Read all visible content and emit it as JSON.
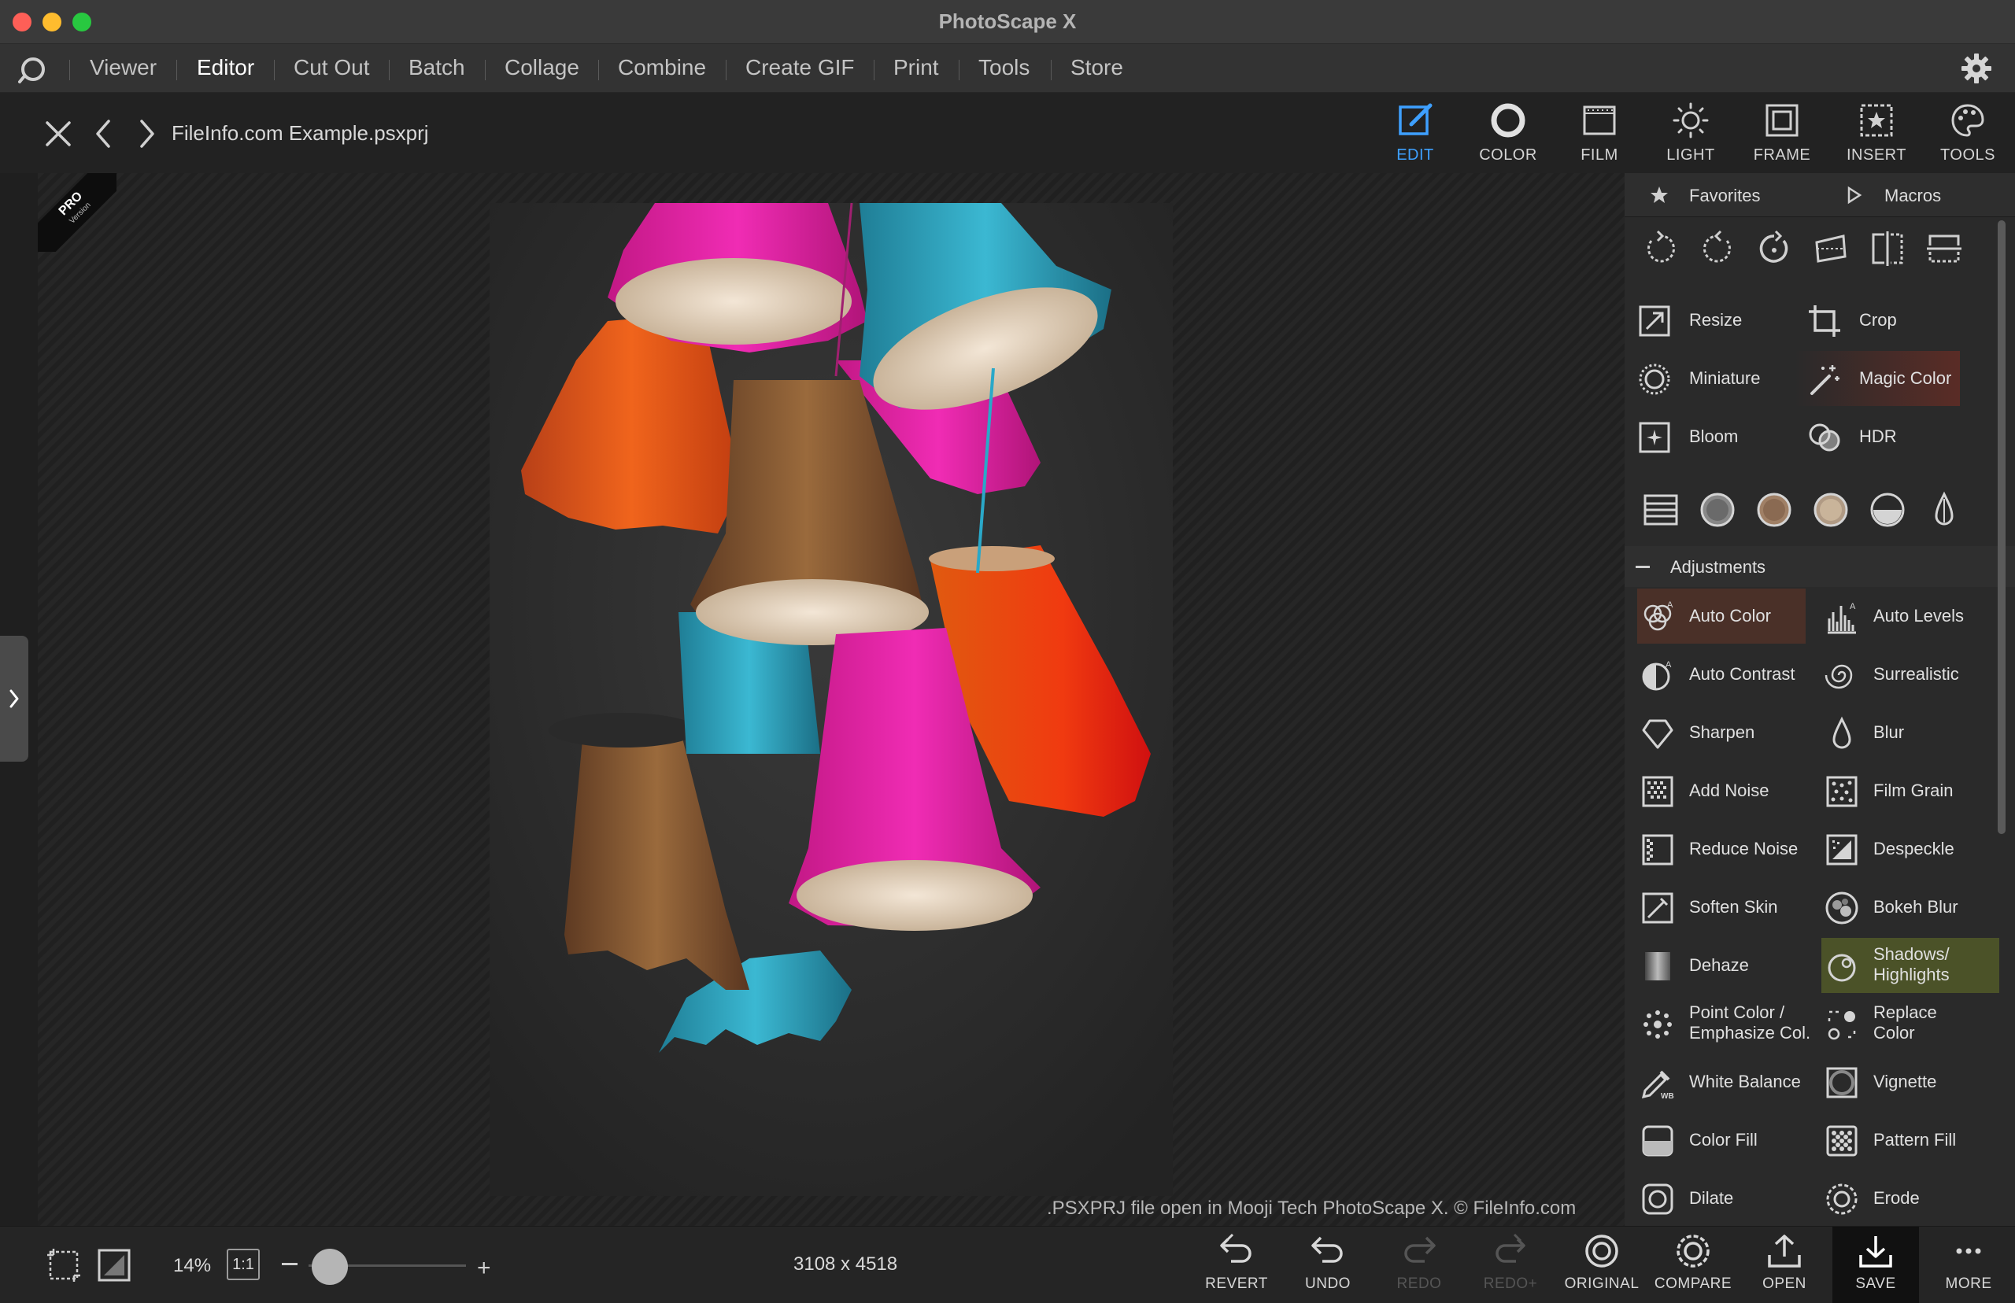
{
  "window": {
    "title": "PhotoScape X"
  },
  "menu": [
    {
      "label": "Viewer",
      "active": false
    },
    {
      "label": "Editor",
      "active": true
    },
    {
      "label": "Cut Out",
      "active": false
    },
    {
      "label": "Batch",
      "active": false
    },
    {
      "label": "Collage",
      "active": false
    },
    {
      "label": "Combine",
      "active": false
    },
    {
      "label": "Create GIF",
      "active": false
    },
    {
      "label": "Print",
      "active": false
    },
    {
      "label": "Tools",
      "active": false
    },
    {
      "label": "Store",
      "active": false
    }
  ],
  "file": {
    "name": "FileInfo.com Example.psxprj"
  },
  "tabs": [
    {
      "label": "EDIT",
      "icon": "edit-icon",
      "active": true
    },
    {
      "label": "COLOR",
      "icon": "color-icon",
      "active": false
    },
    {
      "label": "FILM",
      "icon": "film-icon",
      "active": false
    },
    {
      "label": "LIGHT",
      "icon": "light-icon",
      "active": false
    },
    {
      "label": "FRAME",
      "icon": "frame-icon",
      "active": false
    },
    {
      "label": "INSERT",
      "icon": "insert-icon",
      "active": false
    },
    {
      "label": "TOOLS",
      "icon": "tools-icon",
      "active": false
    }
  ],
  "accent": "#3ea0ff",
  "badge": {
    "line1": "PRO",
    "line2": "Version"
  },
  "watermark": ".PSXPRJ file open in Mooji Tech PhotoScape X. © FileInfo.com",
  "panel": {
    "favorites": "Favorites",
    "macros": "Macros",
    "tools_top": [
      {
        "label": "Resize",
        "icon": "resize-icon"
      },
      {
        "label": "Crop",
        "icon": "crop-icon"
      },
      {
        "label": "Miniature",
        "icon": "miniature-icon"
      },
      {
        "label": "Magic Color",
        "icon": "magic-wand-icon"
      },
      {
        "label": "Bloom",
        "icon": "bloom-icon"
      },
      {
        "label": "HDR",
        "icon": "hdr-icon"
      }
    ],
    "adjustments_title": "Adjustments",
    "adjustments": [
      {
        "label": "Auto Color",
        "icon": "auto-color-icon"
      },
      {
        "label": "Auto Levels",
        "icon": "auto-levels-icon"
      },
      {
        "label": "Auto Contrast",
        "icon": "auto-contrast-icon"
      },
      {
        "label": "Surrealistic",
        "icon": "surrealistic-icon"
      },
      {
        "label": "Sharpen",
        "icon": "sharpen-icon"
      },
      {
        "label": "Blur",
        "icon": "blur-icon"
      },
      {
        "label": "Add Noise",
        "icon": "add-noise-icon"
      },
      {
        "label": "Film Grain",
        "icon": "film-grain-icon"
      },
      {
        "label": "Reduce Noise",
        "icon": "reduce-noise-icon"
      },
      {
        "label": "Despeckle",
        "icon": "despeckle-icon"
      },
      {
        "label": "Soften Skin",
        "icon": "soften-skin-icon"
      },
      {
        "label": "Bokeh Blur",
        "icon": "bokeh-blur-icon"
      },
      {
        "label": "Dehaze",
        "icon": "dehaze-icon"
      },
      {
        "label": "Shadows/",
        "label2": "Highlights",
        "icon": "shadows-highlights-icon"
      },
      {
        "label": "Point Color /",
        "label2": "Emphasize Col.",
        "icon": "point-color-icon"
      },
      {
        "label": "Replace",
        "label2": "Color",
        "icon": "replace-color-icon"
      },
      {
        "label": "White Balance",
        "icon": "white-balance-icon"
      },
      {
        "label": "Vignette",
        "icon": "vignette-icon"
      },
      {
        "label": "Color Fill",
        "icon": "color-fill-icon"
      },
      {
        "label": "Pattern Fill",
        "icon": "pattern-fill-icon"
      },
      {
        "label": "Dilate",
        "icon": "dilate-icon"
      },
      {
        "label": "Erode",
        "icon": "erode-icon"
      }
    ]
  },
  "bottom": {
    "zoom": "14%",
    "one_to_one": "1:1",
    "zoom_level": 0.14,
    "dimensions": "3108 x 4518",
    "actions": [
      {
        "label": "REVERT",
        "icon": "revert-icon",
        "enabled": true
      },
      {
        "label": "UNDO",
        "icon": "undo-icon",
        "enabled": true
      },
      {
        "label": "REDO",
        "icon": "redo-icon",
        "enabled": false
      },
      {
        "label": "REDO+",
        "icon": "redo-plus-icon",
        "enabled": false
      },
      {
        "label": "ORIGINAL",
        "icon": "original-icon",
        "enabled": true
      },
      {
        "label": "COMPARE",
        "icon": "compare-icon",
        "enabled": true
      },
      {
        "label": "OPEN",
        "icon": "open-icon",
        "enabled": true
      },
      {
        "label": "SAVE",
        "icon": "save-icon",
        "enabled": true
      },
      {
        "label": "MORE",
        "icon": "more-icon",
        "enabled": true
      }
    ]
  }
}
